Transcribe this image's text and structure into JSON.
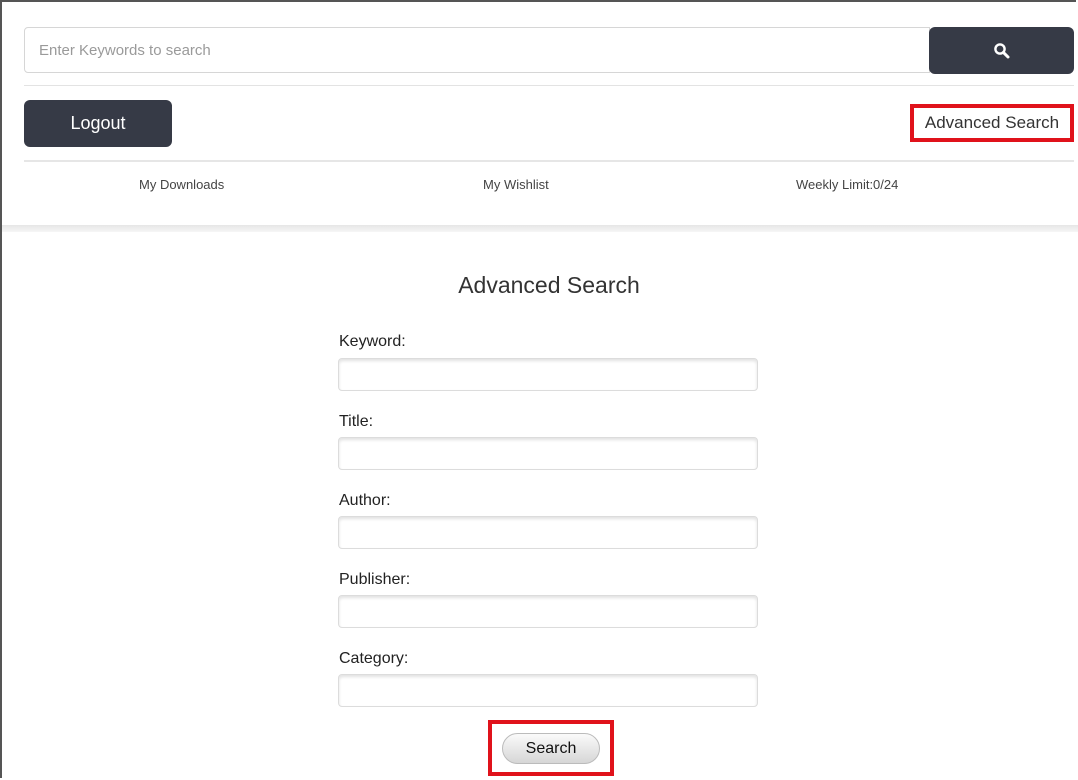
{
  "header": {
    "search_placeholder": "Enter Keywords to search",
    "search_value": "",
    "logout_label": "Logout",
    "advanced_search_link": "Advanced Search"
  },
  "nav": {
    "downloads": "My Downloads",
    "wishlist": "My Wishlist",
    "weekly_limit": "Weekly Limit:0/24"
  },
  "form": {
    "title": "Advanced Search",
    "fields": [
      {
        "label": "Keyword:",
        "value": ""
      },
      {
        "label": "Title:",
        "value": ""
      },
      {
        "label": "Author:",
        "value": ""
      },
      {
        "label": "Publisher:",
        "value": ""
      },
      {
        "label": "Category:",
        "value": ""
      }
    ],
    "submit_label": "Search"
  },
  "colors": {
    "button_dark": "#363a46",
    "highlight_red": "#e0121b"
  },
  "icons": {
    "search_button_icon": "search-icon"
  }
}
